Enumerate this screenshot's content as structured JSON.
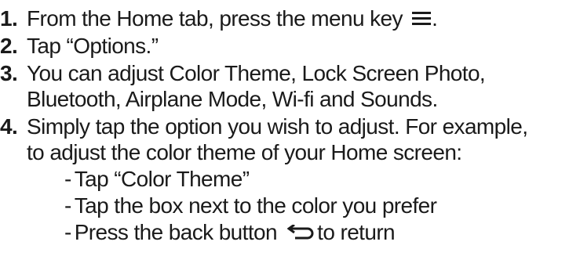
{
  "steps": [
    {
      "number": "1.",
      "text_before_icon": "From the Home tab, press the menu key",
      "icon": "menu-key-icon",
      "text_after_icon": "."
    },
    {
      "number": "2.",
      "text": "Tap “Options.”"
    },
    {
      "number": "3.",
      "line1": "You can adjust Color Theme, Lock Screen Photo,",
      "line2": "Bluetooth, Airplane Mode, Wi-fi and Sounds."
    },
    {
      "number": "4.",
      "line1": "Simply tap the option you wish to adjust. For example,",
      "line2": "to adjust the color theme of your Home screen:"
    }
  ],
  "substeps": {
    "dash": "-",
    "item1": "Tap “Color Theme”",
    "item2": "Tap the box next to the color you prefer",
    "item3_before_icon": "Press the back  button",
    "item3_icon": "back-arrow-icon",
    "item3_after_icon": "to return"
  }
}
